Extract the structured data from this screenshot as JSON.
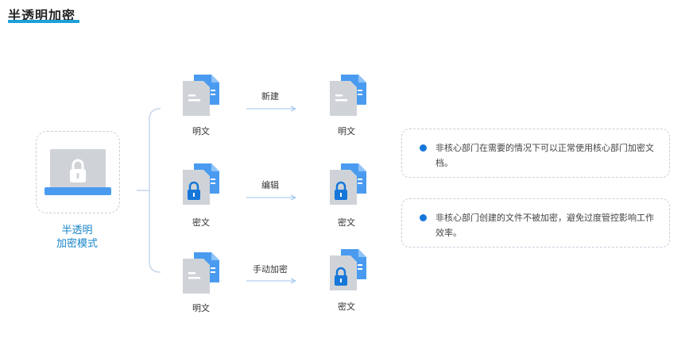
{
  "title": "半透明加密",
  "mode": {
    "label_line1": "半透明",
    "label_line2": "加密模式"
  },
  "rows": [
    {
      "source_label": "明文",
      "action": "新建",
      "target_label": "明文"
    },
    {
      "source_label": "密文",
      "action": "编辑",
      "target_label": "密文"
    },
    {
      "source_label": "明文",
      "action": "手动加密",
      "target_label": "密文"
    }
  ],
  "notes": [
    "非核心部门在需要的情况下可以正常使用核心部门加密文档。",
    "非核心部门创建的文件不被加密，避免过度管控影响工作效率。"
  ],
  "colors": {
    "accent": "#1e9fd8",
    "file_blue": "#4a9bf0",
    "file_gray": "#cfd3d8",
    "lock_blue": "#1677d9",
    "label_blue": "#1a86c8"
  }
}
